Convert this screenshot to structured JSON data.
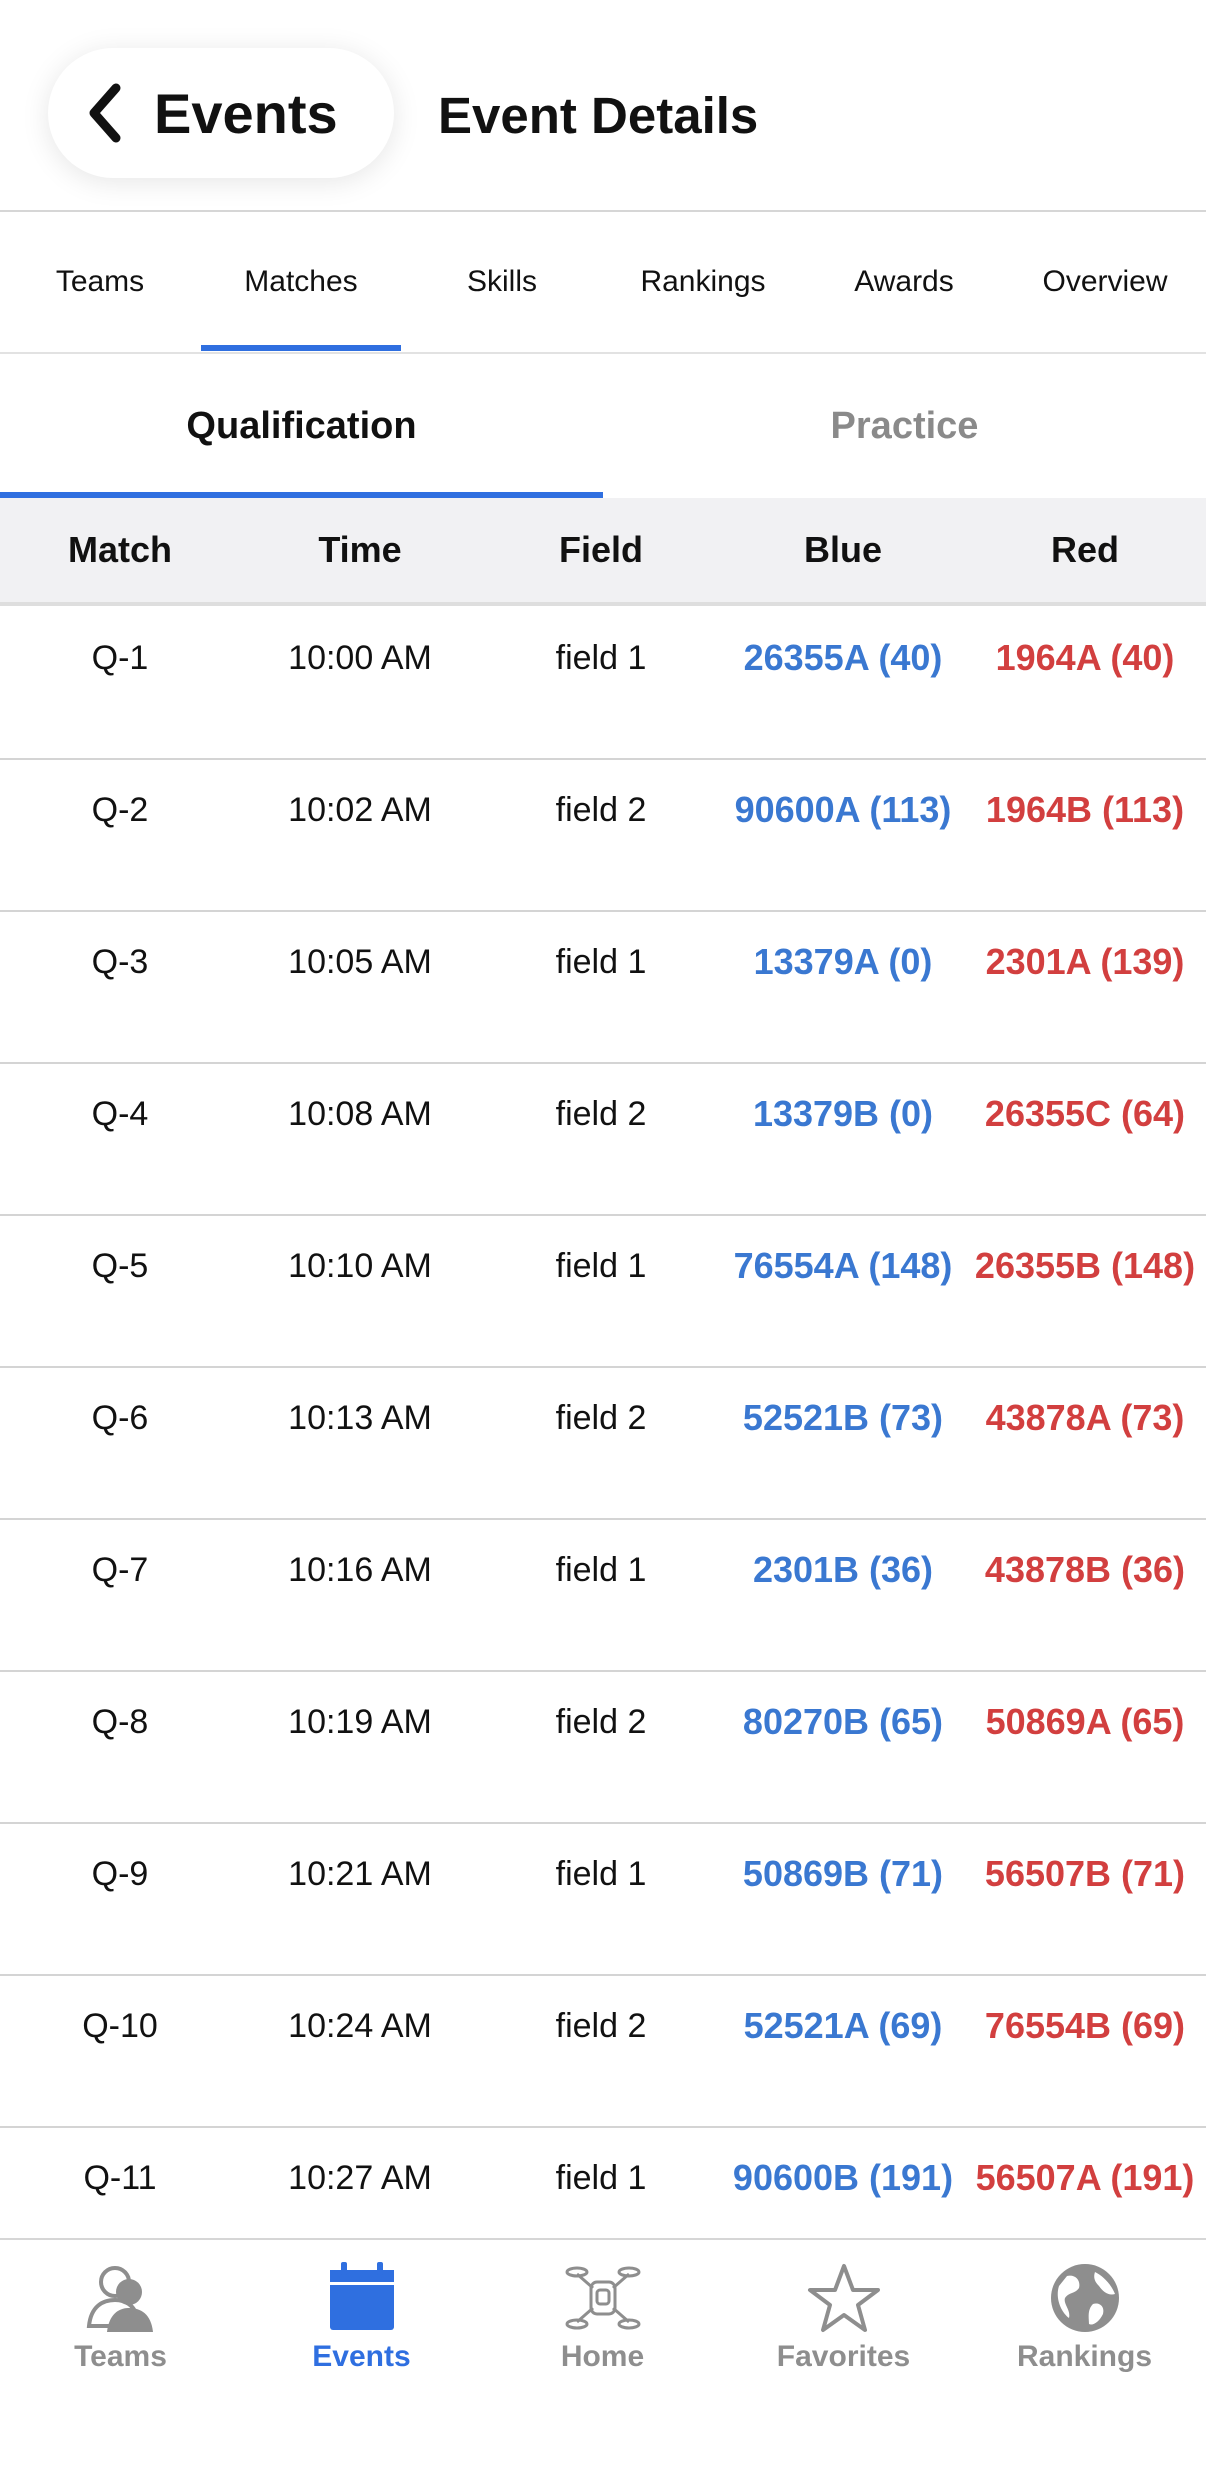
{
  "header": {
    "back_label": "Events",
    "title": "Event Details"
  },
  "tabs": [
    {
      "label": "Teams"
    },
    {
      "label": "Matches"
    },
    {
      "label": "Skills"
    },
    {
      "label": "Rankings"
    },
    {
      "label": "Awards"
    },
    {
      "label": "Overview"
    }
  ],
  "active_tab": "Matches",
  "segment": {
    "active": "Qualification",
    "inactive": "Practice"
  },
  "table": {
    "headers": {
      "match": "Match",
      "time": "Time",
      "field": "Field",
      "blue": "Blue",
      "red": "Red"
    },
    "rows": [
      {
        "match": "Q-1",
        "time": "10:00 AM",
        "field": "field 1",
        "blue": "26355A (40)",
        "red": "1964A (40)"
      },
      {
        "match": "Q-2",
        "time": "10:02 AM",
        "field": "field 2",
        "blue": "90600A (113)",
        "red": "1964B (113)"
      },
      {
        "match": "Q-3",
        "time": "10:05 AM",
        "field": "field 1",
        "blue": "13379A (0)",
        "red": "2301A (139)"
      },
      {
        "match": "Q-4",
        "time": "10:08 AM",
        "field": "field 2",
        "blue": "13379B (0)",
        "red": "26355C (64)"
      },
      {
        "match": "Q-5",
        "time": "10:10 AM",
        "field": "field 1",
        "blue": "76554A (148)",
        "red": "26355B (148)"
      },
      {
        "match": "Q-6",
        "time": "10:13 AM",
        "field": "field 2",
        "blue": "52521B (73)",
        "red": "43878A (73)"
      },
      {
        "match": "Q-7",
        "time": "10:16 AM",
        "field": "field 1",
        "blue": "2301B (36)",
        "red": "43878B (36)"
      },
      {
        "match": "Q-8",
        "time": "10:19 AM",
        "field": "field 2",
        "blue": "80270B (65)",
        "red": "50869A (65)"
      },
      {
        "match": "Q-9",
        "time": "10:21 AM",
        "field": "field 1",
        "blue": "50869B (71)",
        "red": "56507B (71)"
      },
      {
        "match": "Q-10",
        "time": "10:24 AM",
        "field": "field 2",
        "blue": "52521A (69)",
        "red": "76554B (69)"
      },
      {
        "match": "Q-11",
        "time": "10:27 AM",
        "field": "field 1",
        "blue": "90600B (191)",
        "red": "56507A (191)"
      }
    ]
  },
  "bottom_nav": [
    {
      "label": "Teams",
      "icon": "teams-icon"
    },
    {
      "label": "Events",
      "icon": "calendar-icon"
    },
    {
      "label": "Home",
      "icon": "robot-icon"
    },
    {
      "label": "Favorites",
      "icon": "star-icon"
    },
    {
      "label": "Rankings",
      "icon": "globe-icon"
    }
  ],
  "active_nav": "Events",
  "colors": {
    "accent": "#2f6fe0",
    "blue_alliance": "#3a78d1",
    "red_alliance": "#d23f3f",
    "inactive": "#8e8e8e"
  }
}
